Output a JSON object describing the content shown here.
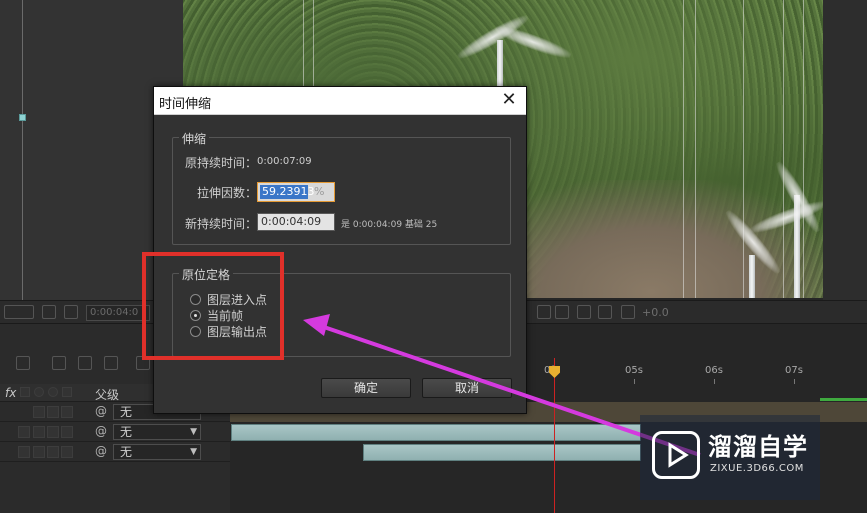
{
  "dialog": {
    "title": "时间伸缩",
    "stretch_group": {
      "label": "伸缩",
      "original_duration_label": "原持续时间：",
      "original_duration_value": "0:00:07:09",
      "stretch_factor_label": "拉伸因数：",
      "stretch_factor_value": "59.23913",
      "stretch_factor_unit": "%",
      "new_duration_label": "新持续时间：",
      "new_duration_value": "0:00:04:09",
      "equals_note": "是 0:00:04:09  基础 25"
    },
    "hold_group": {
      "label": "原位定格",
      "options": [
        {
          "label": "图层进入点",
          "checked": false
        },
        {
          "label": "当前帧",
          "checked": true
        },
        {
          "label": "图层输出点",
          "checked": false
        }
      ]
    },
    "ok_label": "确定",
    "cancel_label": "取消"
  },
  "toolbar": {
    "timecode": "0:00:04:0",
    "zoom_offset": "+0.0"
  },
  "timeline": {
    "header_fx": "fx",
    "parent_label": "父级",
    "ruler": [
      "0f",
      "05s",
      "06s",
      "07s"
    ],
    "layers": [
      {
        "parent": "无"
      },
      {
        "parent": "无"
      },
      {
        "parent": "无"
      }
    ]
  },
  "watermark": {
    "title": "溜溜自学",
    "subtitle": "ZIXUE.3D66.COM"
  },
  "colors": {
    "annotation_red": "#e0302a",
    "arrow_magenta": "#d53adf",
    "playhead": "#cc2222"
  }
}
